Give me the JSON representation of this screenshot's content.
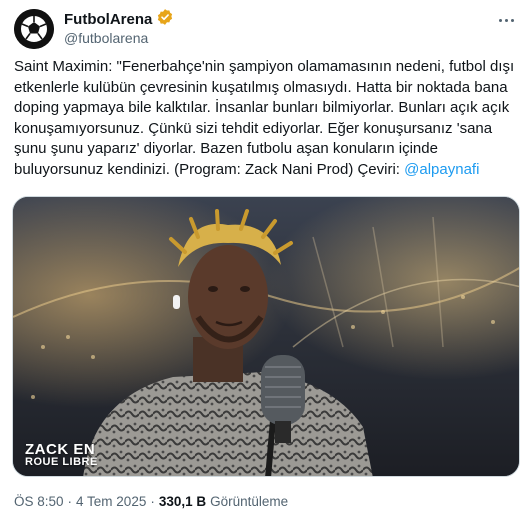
{
  "author": {
    "name": "FutbolArena",
    "handle": "@futbolarena",
    "verified_color": "#e7a51a"
  },
  "tweet": {
    "text": "Saint Maximin: \"Fenerbahçe'nin şampiyon olamamasının nedeni, futbol dışı etkenlerle kulübün çevresinin kuşatılmış olmasıydı. Hatta bir noktada bana doping yapmaya bile kalktılar. İnsanlar bunları bilmiyorlar. Bunları açık açık konuşamıyorsunuz. Çünkü sizi tehdit ediyorlar. Eğer konuşursanız 'sana şunu şunu yaparız' diyorlar. Bazen futbolu aşan konuların içinde buluyorsunuz kendinizi. (Program: Zack Nani Prod) Çeviri: ",
    "mention": "@alpaynafi",
    "accent_color": "#1d9bf0"
  },
  "media": {
    "watermark_line1": "ZACK EN",
    "watermark_line2": "ROUE LIBRE"
  },
  "footer": {
    "time": "ÖS 8:50",
    "separator": "·",
    "date": "4 Tem 2025",
    "views_count": "330,1 B",
    "views_label": "Görüntüleme"
  }
}
